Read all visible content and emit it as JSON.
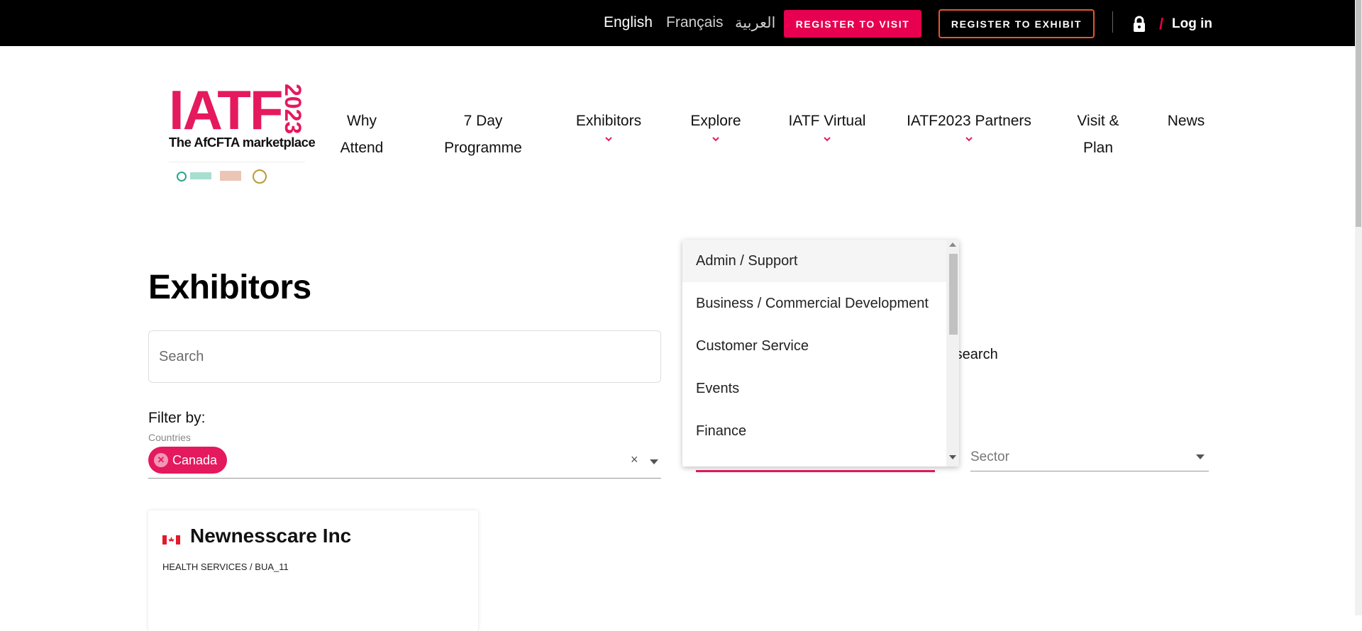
{
  "topbar": {
    "languages": [
      "English",
      "Français",
      "العربية"
    ],
    "register_visit": "REGISTER TO VISIT",
    "register_exhibit": "REGISTER TO EXHIBIT",
    "slash": "/",
    "login": "Log in"
  },
  "logo": {
    "wordmark": "IATF",
    "year": "2023",
    "tagline": "The AfCFTA marketplace"
  },
  "nav": [
    {
      "label": "Why Attend"
    },
    {
      "label": "7 Day Programme"
    },
    {
      "label": "Exhibitors"
    },
    {
      "label": "Explore"
    },
    {
      "label": "IATF Virtual"
    },
    {
      "label": "IATF2023 Partners"
    },
    {
      "label": "Visit & Plan"
    },
    {
      "label": "News"
    }
  ],
  "main": {
    "title": "Exhibitors",
    "search_placeholder": "Search",
    "filter_by": "Filter by:",
    "countries_label": "Countries",
    "selected_country": "Canada",
    "chip_remove": "✕",
    "clear": "×",
    "advanced_search_fragment": "d search",
    "sector_placeholder": "Sector"
  },
  "dropdown": {
    "options": [
      "Admin / Support",
      "Business / Commercial Development",
      "Customer Service",
      "Events",
      "Finance"
    ],
    "highlighted_index": 0
  },
  "card": {
    "name": "Newnesscare Inc",
    "subtitle": "HEALTH SERVICES / BUA_11",
    "flag": "canada-flag"
  },
  "colors": {
    "accent": "#e6004f",
    "exhibit_border": "#e8562a",
    "topbar": "#000000"
  }
}
